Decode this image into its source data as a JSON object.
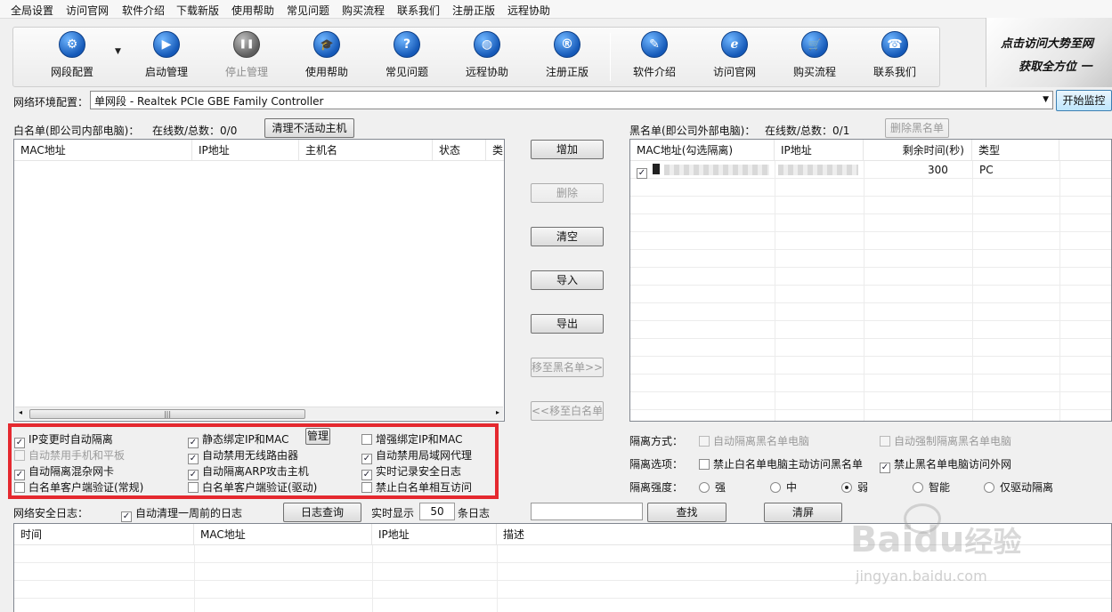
{
  "menu": [
    "全局设置",
    "访问官网",
    "软件介绍",
    "下载新版",
    "使用帮助",
    "常见问题",
    "购买流程",
    "联系我们",
    "注册正版",
    "远程协助"
  ],
  "toolbar": {
    "buttons": [
      {
        "label": "网段配置",
        "icon": "gear-icon",
        "glyph": "⚙"
      },
      {
        "label": "启动管理",
        "icon": "play-icon",
        "glyph": "▶"
      },
      {
        "label": "停止管理",
        "icon": "pause-icon",
        "glyph": "❚❚"
      },
      {
        "label": "使用帮助",
        "icon": "graduation-cap-icon",
        "glyph": "🎓"
      },
      {
        "label": "常见问题",
        "icon": "question-icon",
        "glyph": "?"
      },
      {
        "label": "远程协助",
        "icon": "globe-icon",
        "glyph": "◍"
      },
      {
        "label": "注册正版",
        "icon": "registered-icon",
        "glyph": "®"
      },
      {
        "label": "软件介绍",
        "icon": "document-icon",
        "glyph": "✎"
      },
      {
        "label": "访问官网",
        "icon": "browser-e-icon",
        "glyph": "e"
      },
      {
        "label": "购买流程",
        "icon": "cart-icon",
        "glyph": "🛒"
      },
      {
        "label": "联系我们",
        "icon": "phone-icon",
        "glyph": "☎"
      }
    ],
    "dropdown_arrow": "▼"
  },
  "banner": {
    "line1": "点击访问大势至网",
    "line2": "获取全方位 一"
  },
  "env": {
    "label": "网络环境配置：",
    "value": "单网段 - Realtek PCIe GBE Family Controller",
    "dropdown": "▼",
    "start_button": "开始监控"
  },
  "whitelist": {
    "title": "白名单(即公司内部电脑)：",
    "count_label": "在线数/总数：0/0",
    "clear_button": "清理不活动主机",
    "columns": [
      "MAC地址",
      "IP地址",
      "主机名",
      "状态",
      "类"
    ],
    "scroll": {
      "left": "◂",
      "right": "▸",
      "thumb": "|||"
    }
  },
  "middle_buttons": {
    "add": "增加",
    "delete": "删除",
    "clear": "清空",
    "import": "导入",
    "export": "导出",
    "to_black": "移至黑名单>>",
    "to_white": "<<移至白名单"
  },
  "blacklist": {
    "title": "黑名单(即公司外部电脑)：",
    "count_label": "在线数/总数：0/1",
    "delete_button": "删除黑名单",
    "columns": [
      "MAC地址(勾选隔离)",
      "IP地址",
      "剩余时间(秒)",
      "类型"
    ],
    "rows": [
      {
        "checked": "✓",
        "remaining": "300",
        "type": "PC"
      }
    ]
  },
  "options": {
    "items": [
      {
        "label": "IP变更时自动隔离",
        "checked": true,
        "disabled": false
      },
      {
        "label": "静态绑定IP和MAC",
        "checked": true,
        "disabled": false
      },
      {
        "label": "增强绑定IP和MAC",
        "checked": false,
        "disabled": false
      },
      {
        "label": "自动禁用手机和平板",
        "checked": false,
        "disabled": true
      },
      {
        "label": "自动禁用无线路由器",
        "checked": true,
        "disabled": false
      },
      {
        "label": "自动禁用局域网代理",
        "checked": true,
        "disabled": false
      },
      {
        "label": "自动隔离混杂网卡",
        "checked": true,
        "disabled": false
      },
      {
        "label": "自动隔离ARP攻击主机",
        "checked": true,
        "disabled": false
      },
      {
        "label": "实时记录安全日志",
        "checked": true,
        "disabled": false
      },
      {
        "label": "白名单客户端验证(常规)",
        "checked": false,
        "disabled": false
      },
      {
        "label": "白名单客户端验证(驱动)",
        "checked": false,
        "disabled": false
      },
      {
        "label": "禁止白名单相互访问",
        "checked": false,
        "disabled": false
      }
    ],
    "manage_button": "管理"
  },
  "isolation": {
    "method_label": "隔离方式：",
    "method_opts": [
      "自动隔离黑名单电脑",
      "自动强制隔离黑名单电脑"
    ],
    "option_label": "隔离选项：",
    "option_opts": [
      {
        "label": "禁止白名单电脑主动访问黑名单",
        "checked": false
      },
      {
        "label": "禁止黑名单电脑访问外网",
        "checked": true
      }
    ],
    "strength_label": "隔离强度：",
    "strength_opts": [
      "强",
      "中",
      "弱",
      "智能",
      "仅驱动隔离"
    ],
    "strength_selected": "弱"
  },
  "log": {
    "title": "网络安全日志：",
    "auto_clean": "自动清理一周前的日志",
    "query_button": "日志查询",
    "realtime_label": "实时显示",
    "realtime_value": "50",
    "realtime_unit": "条日志",
    "search_value": "",
    "find_button": "查找",
    "clear_button": "清屏",
    "columns": [
      "时间",
      "MAC地址",
      "IP地址",
      "描述"
    ]
  },
  "watermark": {
    "brand": "Bai",
    "brand2": "du",
    "cn": "经验",
    "url": "jingyan.baidu.com"
  }
}
